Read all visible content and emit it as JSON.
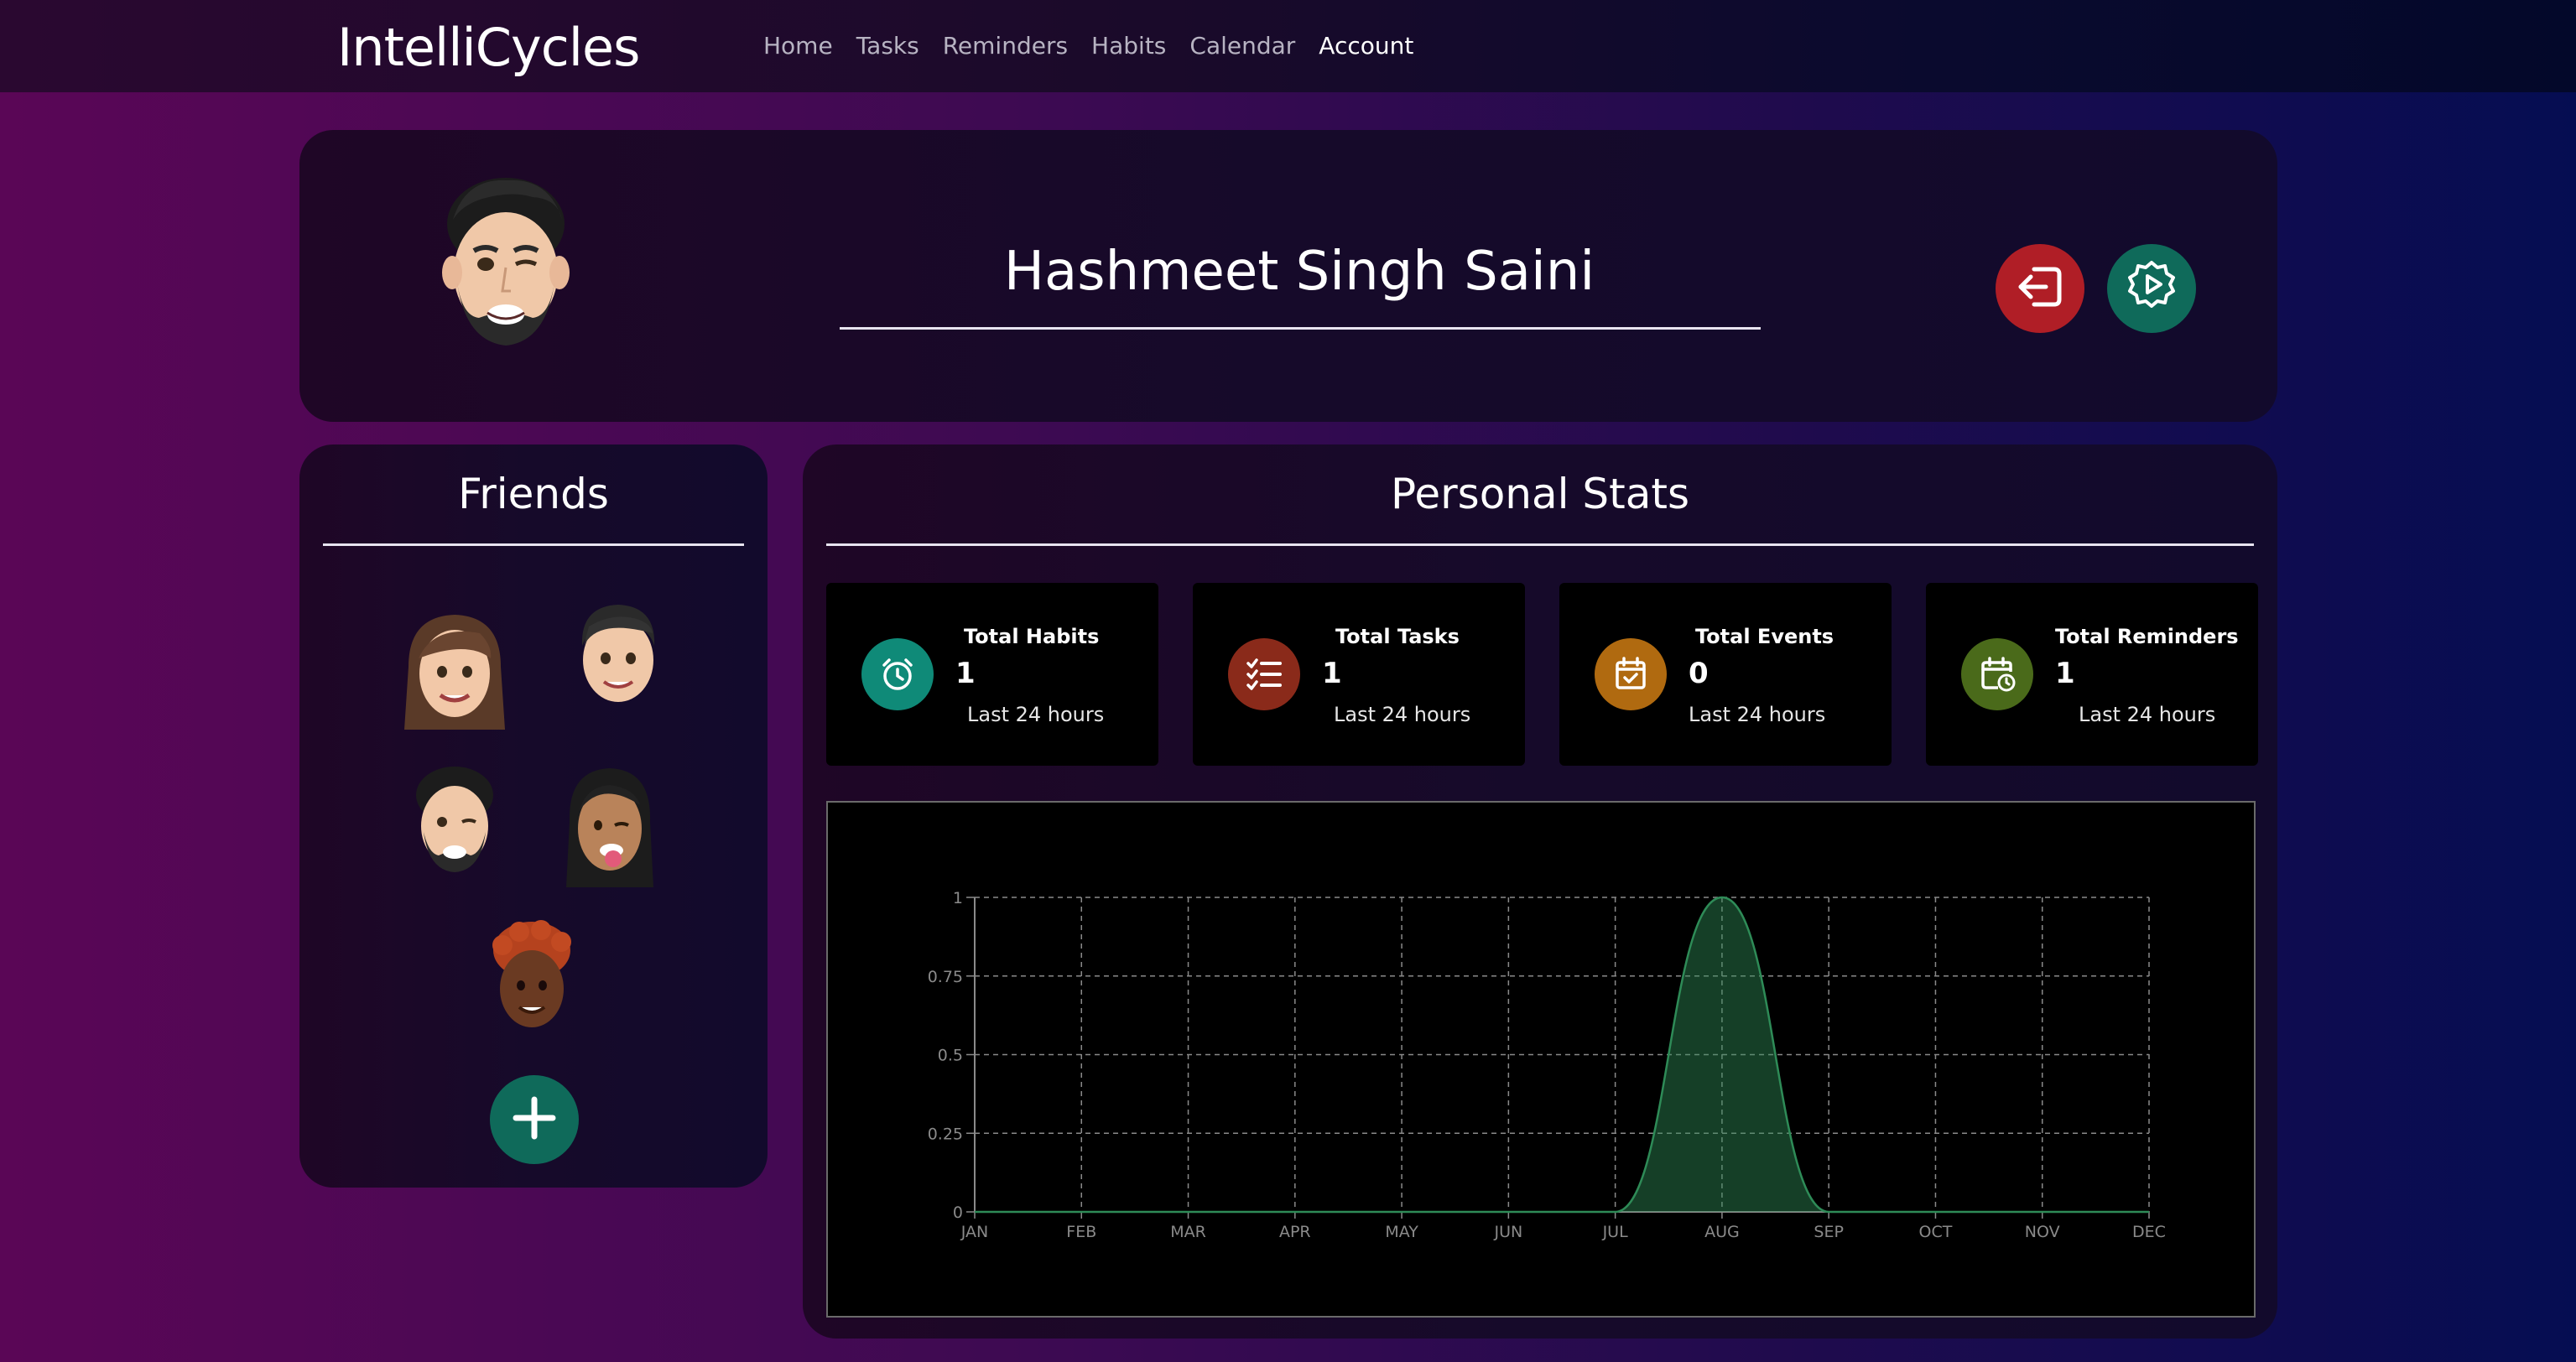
{
  "app": {
    "brand": "IntelliCycles"
  },
  "nav": {
    "items": [
      {
        "label": "Home"
      },
      {
        "label": "Tasks"
      },
      {
        "label": "Reminders"
      },
      {
        "label": "Habits"
      },
      {
        "label": "Calendar"
      },
      {
        "label": "Account",
        "active": true
      }
    ]
  },
  "profile": {
    "name": "Hashmeet Singh Saini",
    "avatar_icon": "memoji-avatar",
    "logout_icon": "logout-icon",
    "settings_icon": "settings-icon"
  },
  "friends": {
    "title": "Friends",
    "items": [
      {
        "icon": "friend-avatar-long-hair"
      },
      {
        "icon": "friend-avatar-short-hair"
      },
      {
        "icon": "friend-avatar-winking-beard"
      },
      {
        "icon": "friend-avatar-tongue-out"
      },
      {
        "icon": "friend-avatar-curly-red-hair"
      }
    ],
    "add_icon": "plus-icon"
  },
  "stats": {
    "title": "Personal Stats",
    "cards": [
      {
        "label": "Total Habits",
        "value": "1",
        "sub": "Last 24 hours",
        "icon": "alarm-clock-icon",
        "color": "#0f8a78"
      },
      {
        "label": "Total Tasks",
        "value": "1",
        "sub": "Last 24 hours",
        "icon": "task-list-icon",
        "color": "#8a2a1a"
      },
      {
        "label": "Total Events",
        "value": "0",
        "sub": "Last 24 hours",
        "icon": "calendar-check-icon",
        "color": "#b06a10"
      },
      {
        "label": "Total Reminders",
        "value": "1",
        "sub": "Last 24 hours",
        "icon": "calendar-clock-icon",
        "color": "#4a6a1a"
      }
    ]
  },
  "chart_data": {
    "type": "area",
    "x": [
      "JAN",
      "FEB",
      "MAR",
      "APR",
      "MAY",
      "JUN",
      "JUL",
      "AUG",
      "SEP",
      "OCT",
      "NOV",
      "DEC"
    ],
    "series": [
      {
        "values": [
          0,
          0,
          0,
          0,
          0,
          0,
          0,
          1,
          0,
          0,
          0,
          0
        ],
        "color": "#2e8b57"
      }
    ],
    "y_ticks": [
      "0",
      "0.25",
      "0.5",
      "0.75",
      "1"
    ],
    "ylim": [
      0,
      1
    ],
    "grid": true
  }
}
